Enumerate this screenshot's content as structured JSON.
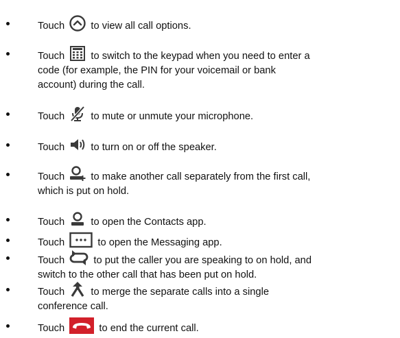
{
  "items": [
    {
      "icon": "chevron-up-circle-icon",
      "before": "Touch",
      "after": "to view all call options."
    },
    {
      "icon": "keypad-icon",
      "before": "Touch",
      "after": "to switch to the keypad when you need to enter a",
      "line2": "code (for example, the PIN for your voicemail or bank",
      "line3": "account) during the call."
    },
    {
      "icon": "mute-microphone-icon",
      "before": "Touch",
      "after": "to mute or unmute your microphone."
    },
    {
      "icon": "speaker-icon",
      "before": "Touch",
      "after": "to turn on or off the speaker."
    },
    {
      "icon": "add-call-icon",
      "before": "Touch",
      "after": "to make another call separately from the first call,",
      "line2": "which is put on hold."
    },
    {
      "icon": "contacts-icon",
      "before": "Touch",
      "after": "to open the Contacts app."
    },
    {
      "icon": "messaging-icon",
      "before": "Touch",
      "after": "to open the Messaging app."
    },
    {
      "icon": "swap-calls-icon",
      "before": "Touch",
      "after": "to put the caller you are speaking to on hold, and",
      "line2": "switch to the other call that has been put on hold."
    },
    {
      "icon": "merge-calls-icon",
      "before": "Touch",
      "after": "to merge the separate calls into a single",
      "line2": "conference call."
    },
    {
      "icon": "end-call-icon",
      "before": "Touch",
      "after": "to end the current call."
    }
  ],
  "colors": {
    "icon_dark": "#3a3a3a",
    "end_call_red": "#d2202a",
    "text": "#111111"
  }
}
